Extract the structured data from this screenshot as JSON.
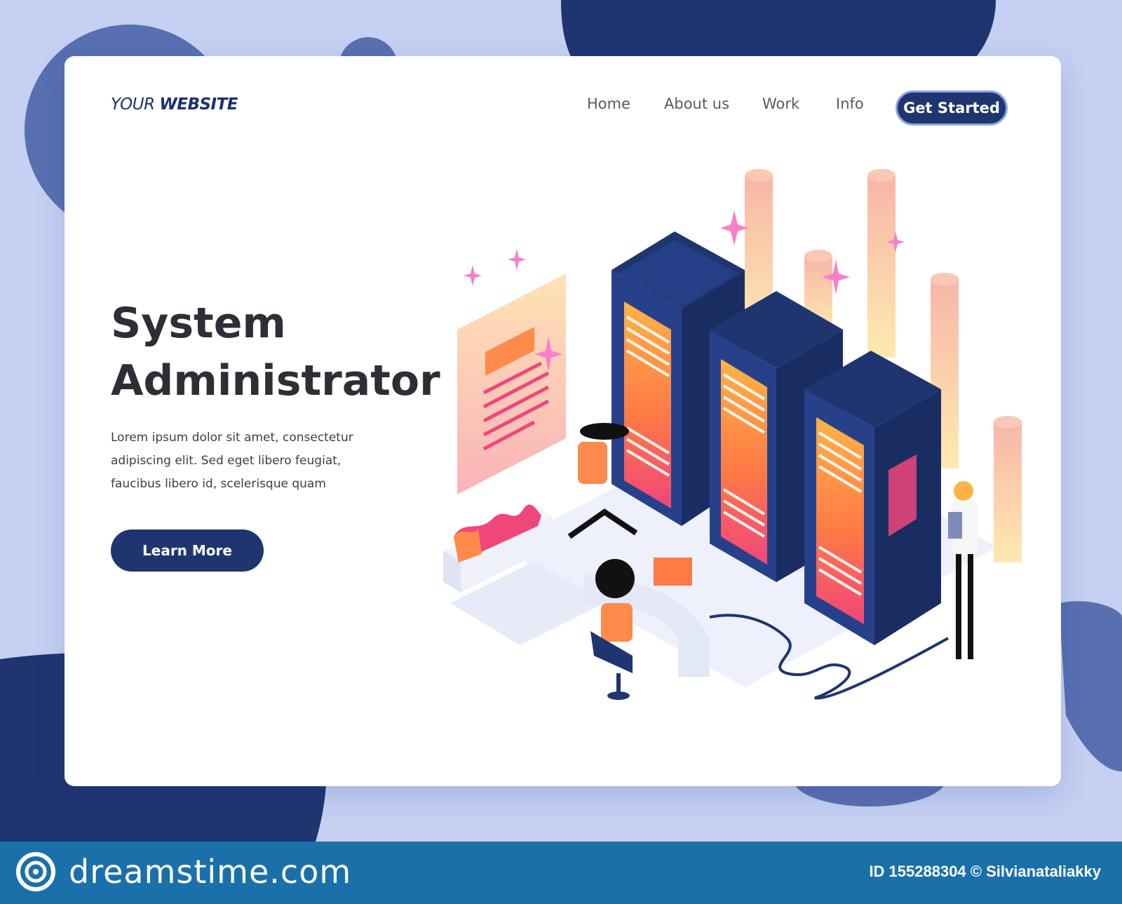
{
  "colors": {
    "page_bg": "#c5d0f2",
    "navy": "#1e3570",
    "blob_mid": "#5870b0",
    "footer_bg": "#1a70a9",
    "accent_orange": "#ff9a3c",
    "accent_pink": "#f0467a"
  },
  "header": {
    "logo_regular": "YOUR ",
    "logo_bold": "WEBSITE",
    "nav": [
      "Home",
      "About us",
      "Work",
      "Info"
    ],
    "cta": "Get Started"
  },
  "hero": {
    "title_line1": "System",
    "title_line2": "Administrator",
    "desc_line1": "Lorem ipsum dolor sit amet, consectetur",
    "desc_line2": "adipiscing elit. Sed eget libero feugiat,",
    "desc_line3": "faucibus libero id, scelerisque quam",
    "cta": "Learn More"
  },
  "footer": {
    "logo_icon": "spiral-icon",
    "brand": "dreamstime.com",
    "credit": "ID 155288304 © Silvianataliakky"
  }
}
